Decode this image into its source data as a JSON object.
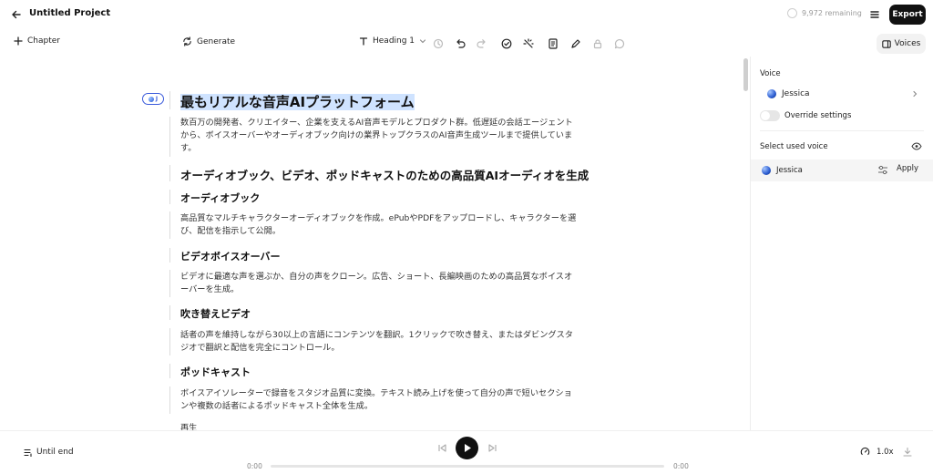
{
  "topbar": {
    "project_title": "Untitled Project",
    "remaining": "9,972 remaining",
    "export_label": "Export"
  },
  "toolbar": {
    "chapter_label": "Chapter",
    "generate_label": "Generate",
    "heading_label": "Heading 1",
    "voices_label": "Voices"
  },
  "document": {
    "badge_letter": "J",
    "heading": "最もリアルな音声AIプラットフォーム",
    "intro_line1": "数百万の開発者、クリエイター、企業を支えるAI音声モデルとプロダクト群。低遅延の会話エージェント",
    "intro_line2": "から、ボイスオーバーやオーディオブック向けの業界トップクラスのAI音声生成ツールまで提供していま",
    "intro_line3": "す。",
    "subheading": "オーディオブック、ビデオ、ポッドキャストのための高品質AIオーディオを生成",
    "s1_title": "オーディオブック",
    "s1_line1": "高品質なマルチキャラクターオーディオブックを作成。ePubやPDFをアップロードし、キャラクターを選",
    "s1_line2": "び、配信を指示して公開。",
    "s2_title": "ビデオボイスオーバー",
    "s2_line1": "ビデオに最適な声を選ぶか、自分の声をクローン。広告、ショート、長編映画のための高品質なボイスオ",
    "s2_line2": "ーバーを生成。",
    "s3_title": "吹き替えビデオ",
    "s3_line1": "話者の声を維持しながら30以上の言語にコンテンツを翻訳。1クリックで吹き替え、またはダビングスタ",
    "s3_line2": "ジオで翻訳と配信を完全にコントロール。",
    "s4_title": "ポッドキャスト",
    "s4_line1": "ボイスアイソレーターで録音をスタジオ品質に変換。テキスト読み上げを使って自分の声で短いセクショ",
    "s4_line2": "ンや複数の話者によるポッドキャスト全体を生成。",
    "cut_line": "再生"
  },
  "panel": {
    "voice_label": "Voice",
    "voice_name": "Jessica",
    "override_label": "Override settings",
    "select_used_label": "Select used voice",
    "used_voice_name": "Jessica",
    "apply_label": "Apply"
  },
  "player": {
    "until_end_label": "Until end",
    "time_start": "0:00",
    "time_end": "0:00",
    "speed_label": "1.0x",
    "progress": 0
  }
}
